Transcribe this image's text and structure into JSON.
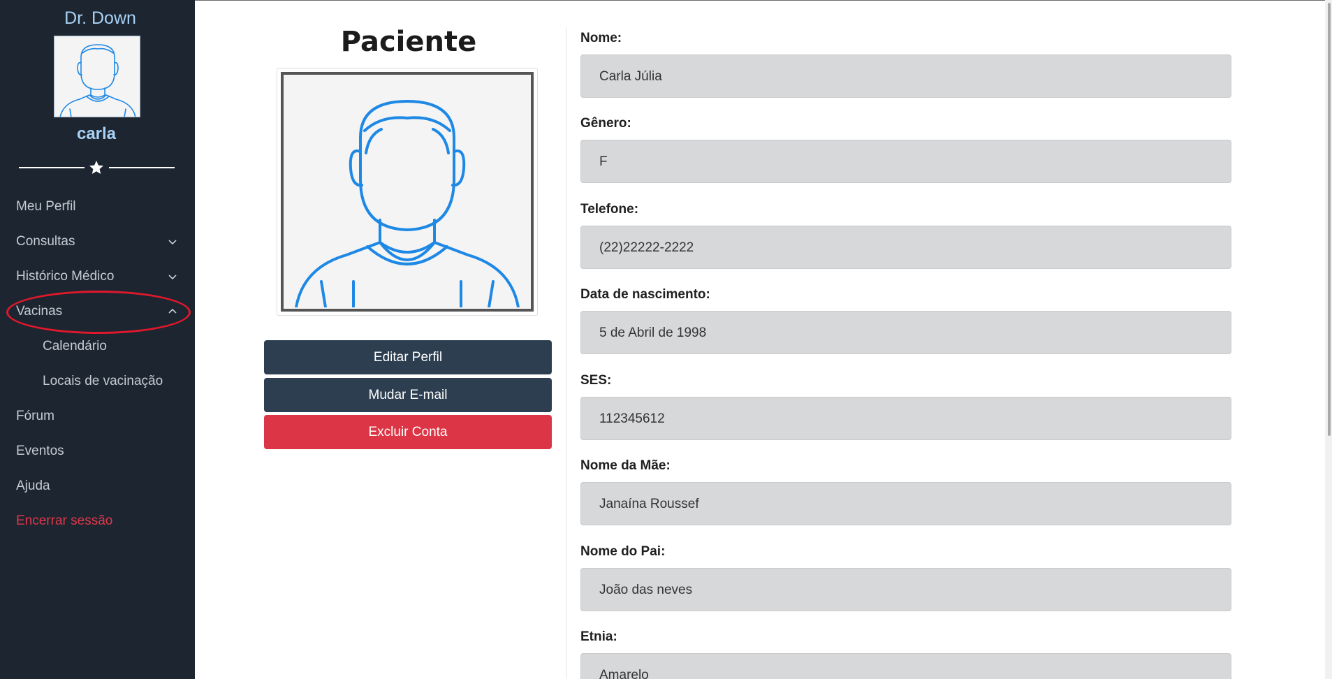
{
  "sidebar": {
    "brand": "Dr. Down",
    "avatar_icon": "user-avatar-icon",
    "username": "carla",
    "divider_icon": "star-icon",
    "items": [
      {
        "label": "Meu Perfil"
      },
      {
        "label": "Consultas",
        "chevron": "chevron-down-icon"
      },
      {
        "label": "Histórico Médico",
        "chevron": "chevron-down-icon"
      },
      {
        "label": "Vacinas",
        "chevron": "chevron-up-icon",
        "expanded": true
      },
      {
        "label": "Calendário",
        "submenu_of": "Vacinas"
      },
      {
        "label": "Locais de vacinação",
        "submenu_of": "Vacinas"
      },
      {
        "label": "Fórum"
      },
      {
        "label": "Eventos"
      },
      {
        "label": "Ajuda"
      },
      {
        "label": "Encerrar sessão",
        "color": "#e0384a"
      }
    ]
  },
  "main": {
    "title": "Paciente",
    "photo_icon": "user-avatar-icon",
    "buttons": {
      "edit": "Editar Perfil",
      "change_email": "Mudar E-mail",
      "delete": "Excluir Conta"
    },
    "fields": [
      {
        "label": "Nome:",
        "value": "Carla Júlia"
      },
      {
        "label": "Gênero:",
        "value": "F"
      },
      {
        "label": "Telefone:",
        "value": "(22)22222-2222"
      },
      {
        "label": "Data de nascimento:",
        "value": "5 de Abril de 1998"
      },
      {
        "label": "SES:",
        "value": "112345612"
      },
      {
        "label": "Nome da Mãe:",
        "value": "Janaína Roussef"
      },
      {
        "label": "Nome do Pai:",
        "value": "João das neves"
      },
      {
        "label": "Etnia:",
        "value": "Amarelo"
      }
    ]
  },
  "colors": {
    "sidebar_bg": "#1c2530",
    "accent": "#a9d2f5",
    "primary_button": "#2c3e50",
    "danger_button": "#dc3545",
    "highlight_annotation": "#e0182c"
  }
}
